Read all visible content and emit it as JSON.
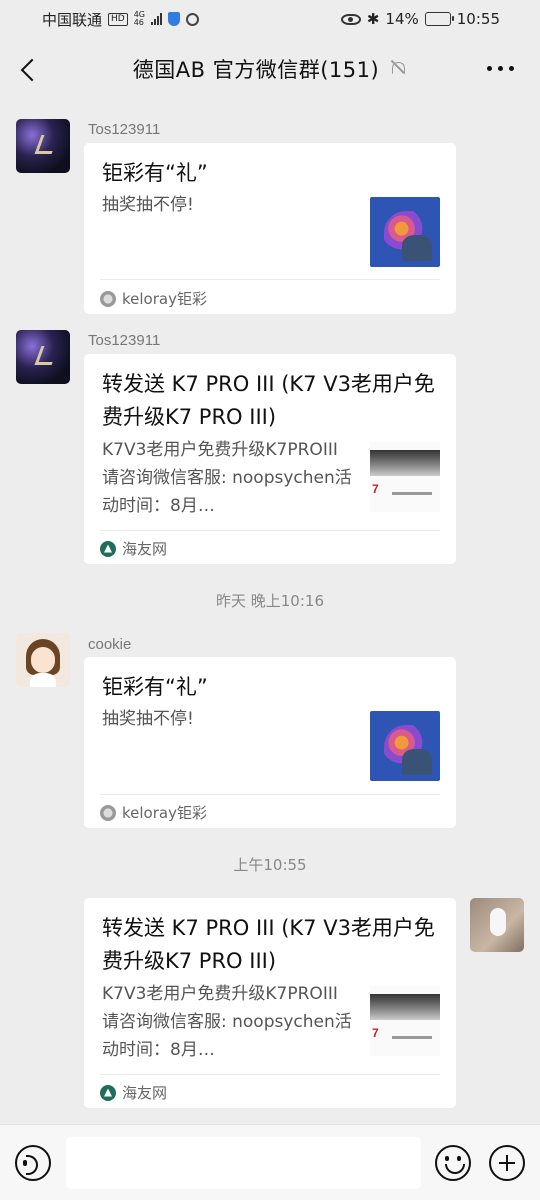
{
  "status_bar": {
    "carrier": "中国联通",
    "hd_badge": "HD",
    "network_top": "4G",
    "network_bottom": "46",
    "battery": "14%",
    "battery_level": 0.14,
    "time": "10:55"
  },
  "header": {
    "title": "德国AB  官方微信群(151)",
    "icons": {
      "back": "back-arrow-icon",
      "mute": "bell-mute-icon",
      "more": "more-dots-icon"
    }
  },
  "messages": [
    {
      "sender": "Tos123911",
      "card": {
        "title": "钜彩有“礼”",
        "description": "抽奖抽不停!",
        "source": "keloray钜彩"
      }
    },
    {
      "sender": "Tos123911",
      "card": {
        "title": "转发送 K7 PRO III (K7 V3老用户免费升级K7 PRO III)",
        "description": "K7V3老用户免费升级K7PROIII请咨询微信客服: noopsychen活动时间：8月…",
        "source": "海友网"
      }
    },
    {
      "sender": "cookie",
      "card": {
        "title": "钜彩有“礼”",
        "description": "抽奖抽不停!",
        "source": "keloray钜彩"
      }
    },
    {
      "sender": "",
      "card": {
        "title": "转发送 K7 PRO III (K7 V3老用户免费升级K7 PRO III)",
        "description": "K7V3老用户免费升级K7PROIII请咨询微信客服: noopsychen活动时间：8月…",
        "source": "海友网"
      }
    }
  ],
  "time_separators": [
    "昨天 晚上10:16",
    "上午10:55"
  ],
  "input_bar": {
    "text_value": "",
    "icons": {
      "voice": "voice-icon",
      "emoji": "emoji-icon",
      "plus": "plus-icon"
    }
  }
}
